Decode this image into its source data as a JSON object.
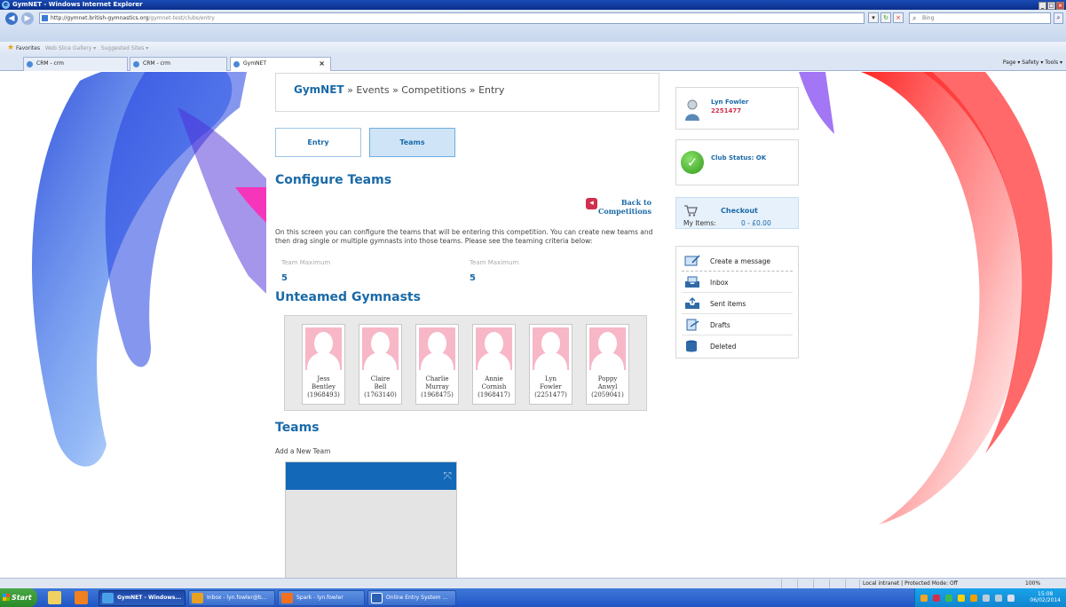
{
  "window": {
    "title": "GymNET - Windows Internet Explorer",
    "url_host": "http://gymnet.british-gymnastics.org",
    "url_path": "/gymnet-test/clubs/entry",
    "search_placeholder": "Bing"
  },
  "favorites": {
    "label": "Favorites",
    "items": [
      "Web Slice Gallery ▾",
      "Suggested Sites ▾"
    ]
  },
  "tabs": [
    {
      "label": "CRM - crm"
    },
    {
      "label": "CRM - crm"
    },
    {
      "label": "GymNET"
    }
  ],
  "command_bar": "Page ▾   Safety ▾   Tools ▾",
  "breadcrumb": {
    "home": "GymNET",
    "path": " » Events » Competitions » Entry"
  },
  "page_tabs": {
    "entry": "Entry",
    "teams": "Teams"
  },
  "configure": {
    "title": "Configure Teams",
    "back_line1": "Back to",
    "back_line2": "Competitions",
    "description": "On this screen you can configure the teams that will be entering this competition. You can create new teams and then drag single or multiple gymnasts into those teams. Please see the teaming criteria below:",
    "criteria": [
      {
        "label": "Team Maximum",
        "value": "5"
      },
      {
        "label": "Team Maximum",
        "value": "5"
      }
    ]
  },
  "unteamed": {
    "title": "Unteamed Gymnasts",
    "gymnasts": [
      {
        "first": "Jess",
        "last": "Bentley",
        "id": "(1968493)"
      },
      {
        "first": "Claire",
        "last": "Bell",
        "id": "(1763140)"
      },
      {
        "first": "Charlie",
        "last": "Murray",
        "id": "(1968475)"
      },
      {
        "first": "Annie",
        "last": "Cornish",
        "id": "(1968417)"
      },
      {
        "first": "Lyn",
        "last": "Fowler",
        "id": "(2251477)"
      },
      {
        "first": "Poppy",
        "last": "Anwyl",
        "id": "(2059041)"
      }
    ]
  },
  "teams": {
    "title": "Teams",
    "add_label": "Add a New Team"
  },
  "sidebar": {
    "user_name": "Lyn Fowler",
    "user_id": "2251477",
    "club_status": "Club Status: OK",
    "checkout_label": "Checkout",
    "my_items_label": "My Items:",
    "my_items_value": "0  -  £0.00",
    "messages": [
      {
        "label": "Create a message"
      },
      {
        "label": "Inbox"
      },
      {
        "label": "Sent items"
      },
      {
        "label": "Drafts"
      },
      {
        "label": "Deleted"
      }
    ]
  },
  "statusbar": {
    "zone": "Local intranet | Protected Mode: Off",
    "zoom": "100%"
  },
  "taskbar": {
    "start": "Start",
    "buttons": [
      {
        "label": "GymNET - Windows..."
      },
      {
        "label": "Inbox - lyn.fowler@b..."
      },
      {
        "label": "Spark - lyn.fowler"
      },
      {
        "label": "Online Entry System ..."
      }
    ],
    "time": "15:08",
    "date": "06/02/2014"
  },
  "colors": {
    "accent": "#1a6aa8",
    "alert": "#d0304e",
    "team_header": "#1468b8",
    "avatar_placeholder": "#f7b7c7"
  }
}
